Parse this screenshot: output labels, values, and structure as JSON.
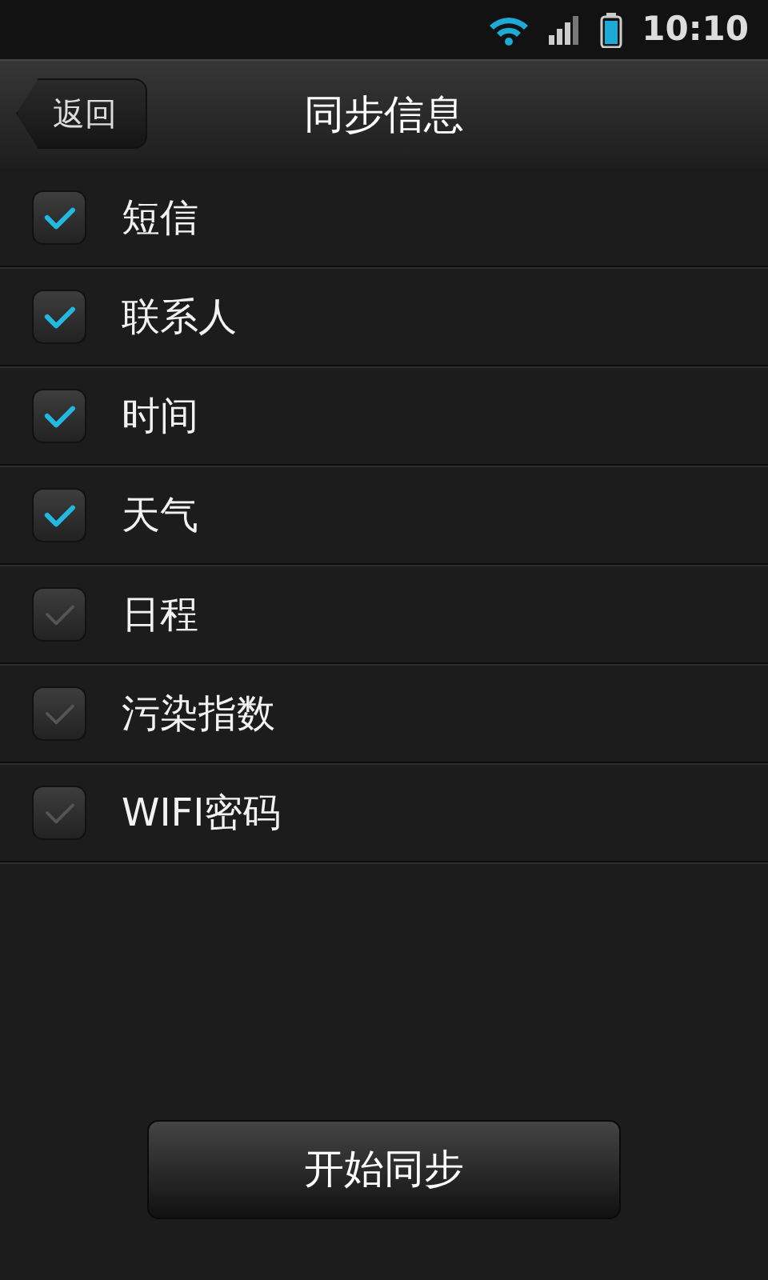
{
  "status_bar": {
    "time": "10:10"
  },
  "header": {
    "back": "返回",
    "title": "同步信息"
  },
  "items": [
    {
      "label": "短信",
      "checked": true
    },
    {
      "label": "联系人",
      "checked": true
    },
    {
      "label": "时间",
      "checked": true
    },
    {
      "label": "天气",
      "checked": true
    },
    {
      "label": "日程",
      "checked": false
    },
    {
      "label": "污染指数",
      "checked": false
    },
    {
      "label": "WIFI密码",
      "checked": false
    }
  ],
  "action": {
    "label": "开始同步"
  }
}
